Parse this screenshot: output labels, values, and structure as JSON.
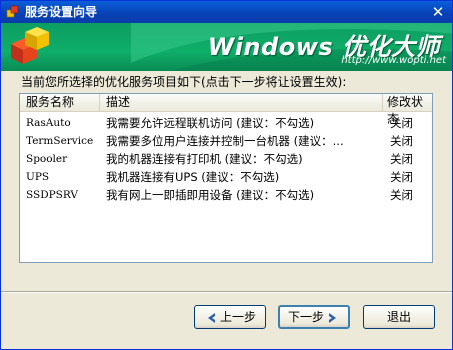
{
  "window": {
    "title": "服务设置向导",
    "close_glyph": "✕"
  },
  "banner": {
    "brand": "Windows 优化大师",
    "url": "http://www.wopti.net"
  },
  "instruction": "当前您所选择的优化服务项目如下(点击下一步将让设置生效):",
  "list": {
    "columns": [
      "服务名称",
      "描述",
      "修改状态"
    ],
    "rows": [
      {
        "name": "RasAuto",
        "desc": "我需要允许远程联机访问 (建议：不勾选)",
        "status": "关闭"
      },
      {
        "name": "TermService",
        "desc": "我需要多位用户连接并控制一台机器 (建议：...",
        "status": "关闭"
      },
      {
        "name": "Spooler",
        "desc": "我的机器连接有打印机 (建议：不勾选)",
        "status": "关闭"
      },
      {
        "name": "UPS",
        "desc": "我机器连接有UPS (建议：不勾选)",
        "status": "关闭"
      },
      {
        "name": "SSDPSRV",
        "desc": "我有网上一即插即用设备 (建议：不勾选)",
        "status": "关闭"
      }
    ]
  },
  "buttons": {
    "prev": "上一步",
    "next": "下一步",
    "exit": "退出"
  },
  "colors": {
    "titlebar": "#0842b8",
    "banner": "#0fae69",
    "arrow": "#2a5db0"
  },
  "icons": {
    "app": "cubes-icon",
    "prev": "chevron-left-icon",
    "next": "chevron-right-icon"
  }
}
